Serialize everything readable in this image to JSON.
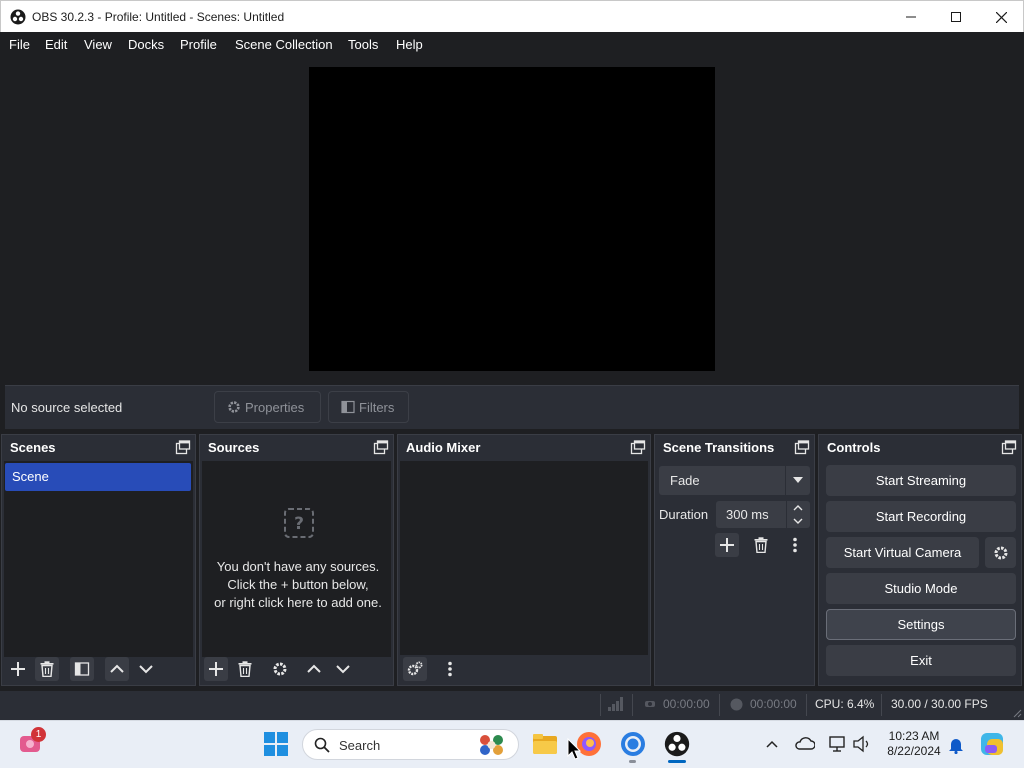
{
  "window": {
    "title": "OBS 30.2.3 - Profile: Untitled - Scenes: Untitled"
  },
  "menu": [
    "File",
    "Edit",
    "View",
    "Docks",
    "Profile",
    "Scene Collection",
    "Tools",
    "Help"
  ],
  "context_bar": {
    "label": "No source selected",
    "properties": "Properties",
    "filters": "Filters"
  },
  "docks": {
    "scenes": {
      "title": "Scenes",
      "items": [
        "Scene"
      ]
    },
    "sources": {
      "title": "Sources",
      "empty_line1": "You don't have any sources.",
      "empty_line2": "Click the + button below,",
      "empty_line3": "or right click here to add one."
    },
    "audio_mixer": {
      "title": "Audio Mixer"
    },
    "transitions": {
      "title": "Scene Transitions",
      "selected": "Fade",
      "duration_label": "Duration",
      "duration_value": "300 ms"
    },
    "controls": {
      "title": "Controls",
      "start_streaming": "Start Streaming",
      "start_recording": "Start Recording",
      "start_virtual_camera": "Start Virtual Camera",
      "studio_mode": "Studio Mode",
      "settings": "Settings",
      "exit": "Exit"
    }
  },
  "status": {
    "stream_time": "00:00:00",
    "record_time": "00:00:00",
    "cpu": "CPU: 6.4%",
    "fps": "30.00 / 30.00 FPS"
  },
  "taskbar": {
    "search_placeholder": "Search",
    "notification_count": "1",
    "time": "10:23 AM",
    "date": "8/22/2024"
  },
  "colors": {
    "accent": "#284cb8",
    "dock_bg": "#2b2e36",
    "canvas_bg": "#1e1f22"
  }
}
